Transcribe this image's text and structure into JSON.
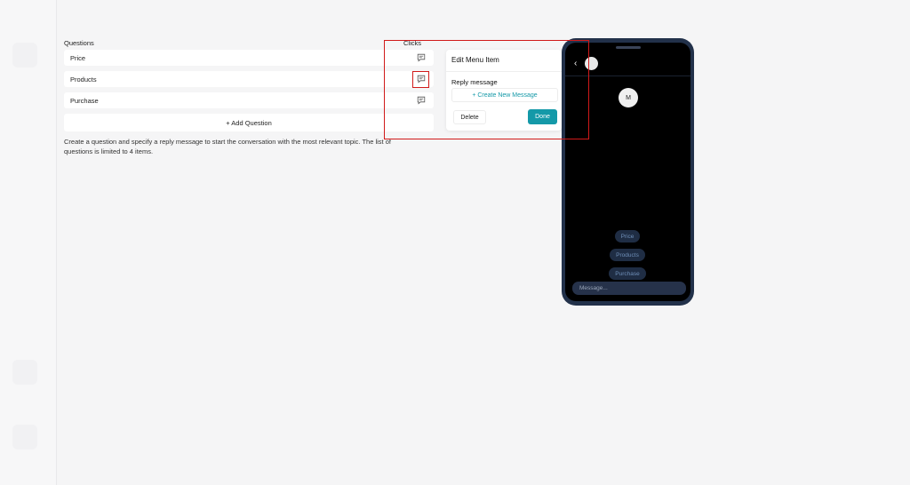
{
  "panel": {
    "questions_header": "Questions",
    "clicks_header": "Clicks",
    "questions": [
      {
        "label": "Price"
      },
      {
        "label": "Products"
      },
      {
        "label": "Purchase"
      }
    ],
    "add_question_label": "+ Add Question",
    "helper_text": "Create a question and specify a reply message to start the conversation with the most relevant topic. The list of questions is limited to 4 items."
  },
  "popup": {
    "title": "Edit Menu Item",
    "reply_label": "Reply message",
    "create_message_label": "+ Create New Message",
    "delete_label": "Delete",
    "done_label": "Done"
  },
  "phone": {
    "back_icon": "chevron-left-icon",
    "avatar_initial": "M",
    "quick_replies": [
      "Price",
      "Products",
      "Purchase"
    ],
    "message_placeholder": "Message..."
  },
  "colors": {
    "accent": "#1499a8",
    "highlight": "#d11a1a",
    "phone_frame": "#22314a"
  }
}
